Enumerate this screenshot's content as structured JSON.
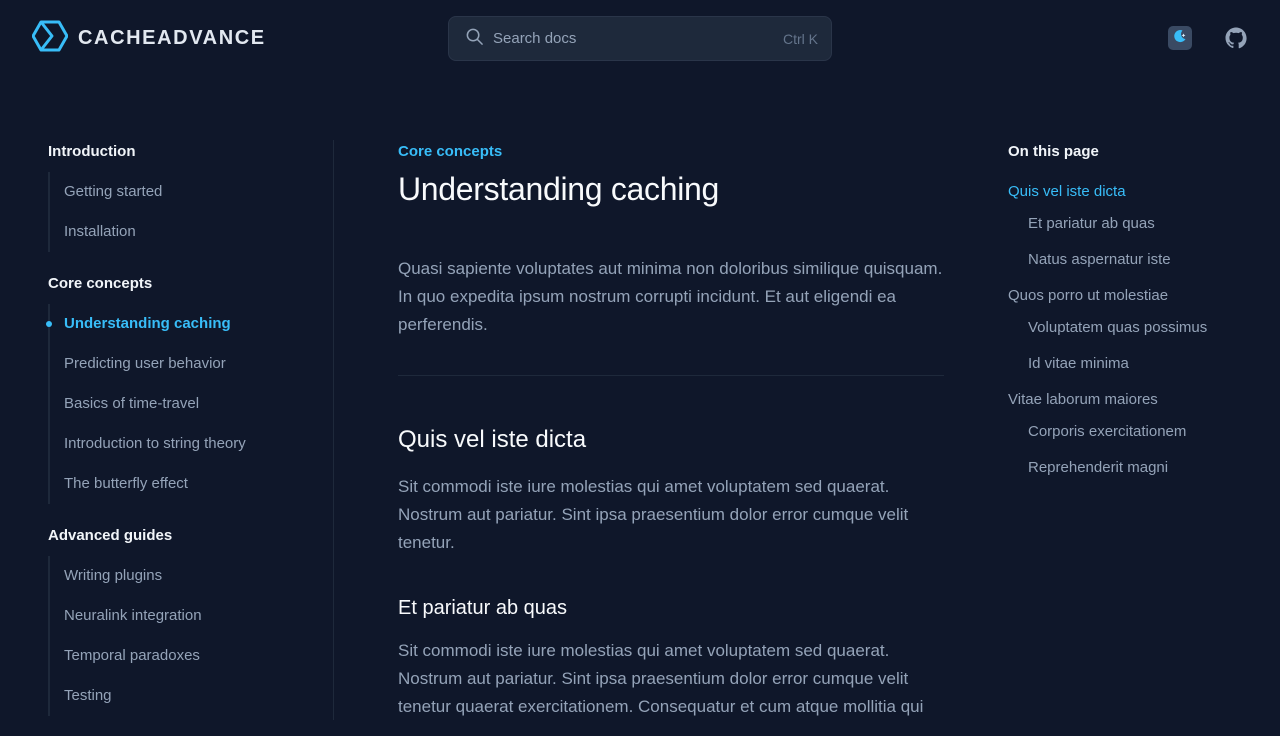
{
  "header": {
    "logo_text": "CACHEADVANCE",
    "search_placeholder": "Search docs",
    "search_shortcut": "Ctrl K",
    "colors": {
      "accent": "#38bdf8",
      "background": "#0f172a"
    }
  },
  "sidebar": {
    "sections": [
      {
        "title": "Introduction",
        "items": [
          "Getting started",
          "Installation"
        ]
      },
      {
        "title": "Core concepts",
        "items": [
          "Understanding caching",
          "Predicting user behavior",
          "Basics of time-travel",
          "Introduction to string theory",
          "The butterfly effect"
        ]
      },
      {
        "title": "Advanced guides",
        "items": [
          "Writing plugins",
          "Neuralink integration",
          "Temporal paradoxes",
          "Testing"
        ]
      }
    ],
    "active_item": "Understanding caching"
  },
  "main": {
    "eyebrow": "Core concepts",
    "title": "Understanding caching",
    "lead": "Quasi sapiente voluptates aut minima non doloribus similique quisquam. In quo expedita ipsum nostrum corrupti incidunt. Et aut eligendi ea perferendis.",
    "h2": "Quis vel iste dicta",
    "para1": "Sit commodi iste iure molestias qui amet voluptatem sed quaerat. Nostrum aut pariatur. Sint ipsa praesentium dolor error cumque velit tenetur.",
    "h3": "Et pariatur ab quas",
    "para2": "Sit commodi iste iure molestias qui amet voluptatem sed quaerat. Nostrum aut pariatur. Sint ipsa praesentium dolor error cumque velit tenetur quaerat exercitationem. Consequatur et cum atque mollitia qui"
  },
  "toc": {
    "heading": "On this page",
    "items": [
      {
        "label": "Quis vel iste dicta",
        "level": 1,
        "active": true
      },
      {
        "label": "Et pariatur ab quas",
        "level": 2
      },
      {
        "label": "Natus aspernatur iste",
        "level": 2
      },
      {
        "label": "Quos porro ut molestiae",
        "level": 1
      },
      {
        "label": "Voluptatem quas possimus",
        "level": 2
      },
      {
        "label": "Id vitae minima",
        "level": 2
      },
      {
        "label": "Vitae laborum maiores",
        "level": 1
      },
      {
        "label": "Corporis exercitationem",
        "level": 2
      },
      {
        "label": "Reprehenderit magni",
        "level": 2
      }
    ]
  }
}
